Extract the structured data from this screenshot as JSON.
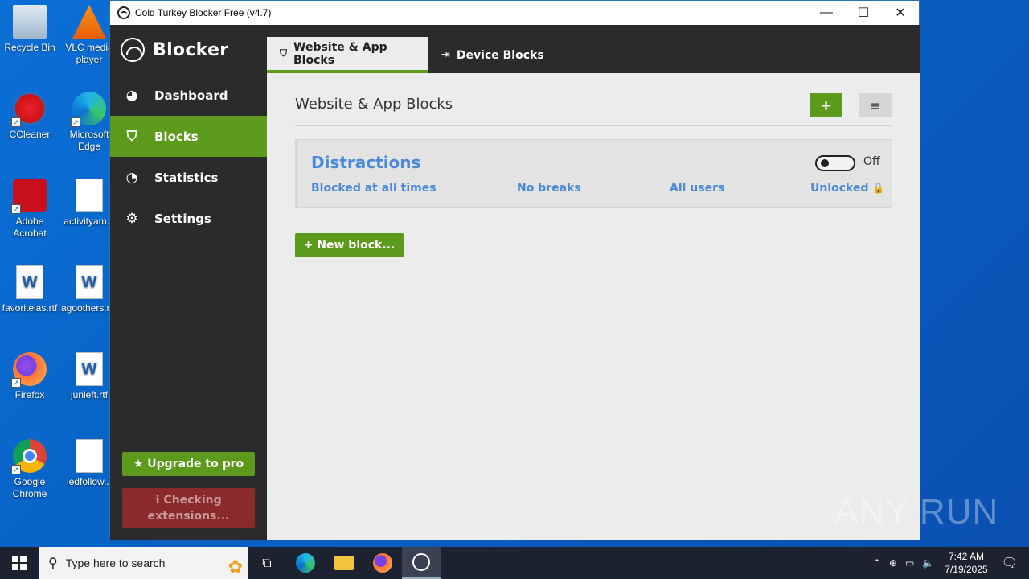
{
  "desktop": {
    "icons": [
      {
        "label": "Recycle Bin",
        "icon": "recycle-bin-icon"
      },
      {
        "label": "VLC media player",
        "icon": "vlc-icon"
      },
      {
        "label": "CCleaner",
        "icon": "ccleaner-icon"
      },
      {
        "label": "Microsoft Edge",
        "icon": "edge-icon"
      },
      {
        "label": "Adobe Acrobat",
        "icon": "acrobat-icon"
      },
      {
        "label": "activityam...",
        "icon": "image-file-icon"
      },
      {
        "label": "favoritelas.rtf",
        "icon": "word-doc-icon"
      },
      {
        "label": "agoothers.r...",
        "icon": "word-doc-icon"
      },
      {
        "label": "Firefox",
        "icon": "firefox-icon"
      },
      {
        "label": "junleft.rtf",
        "icon": "word-doc-icon"
      },
      {
        "label": "Google Chrome",
        "icon": "chrome-icon"
      },
      {
        "label": "ledfollow...",
        "icon": "image-file-icon"
      }
    ]
  },
  "window": {
    "title": "Cold Turkey Blocker Free (v4.7)",
    "controls": {
      "minimize": "—",
      "maximize": "☐",
      "close": "✕"
    }
  },
  "sidebar": {
    "brand": "Blocker",
    "items": [
      {
        "label": "Dashboard",
        "icon": "dashboard-icon",
        "active": false
      },
      {
        "label": "Blocks",
        "icon": "shield-icon",
        "active": true
      },
      {
        "label": "Statistics",
        "icon": "pie-chart-icon",
        "active": false
      },
      {
        "label": "Settings",
        "icon": "gear-icon",
        "active": false
      }
    ],
    "upgrade_label": "★ Upgrade to pro",
    "checking_label": "ℹ Checking extensions..."
  },
  "tabs": [
    {
      "label": "Website & App Blocks",
      "icon": "shield-icon",
      "active": true
    },
    {
      "label": "Device Blocks",
      "icon": "sign-in-icon",
      "active": false
    }
  ],
  "main": {
    "heading": "Website & App Blocks",
    "add_label": "+",
    "menu_label": "≡",
    "block": {
      "name": "Distractions",
      "toggle_state": "Off",
      "schedule": "Blocked at all times",
      "breaks": "No breaks",
      "users": "All users",
      "lock": "Unlocked"
    },
    "new_block_label": "+ New block..."
  },
  "taskbar": {
    "search_placeholder": "Type here to search",
    "time": "7:42 AM",
    "date": "7/19/2025"
  },
  "watermark": "ANY RUN"
}
